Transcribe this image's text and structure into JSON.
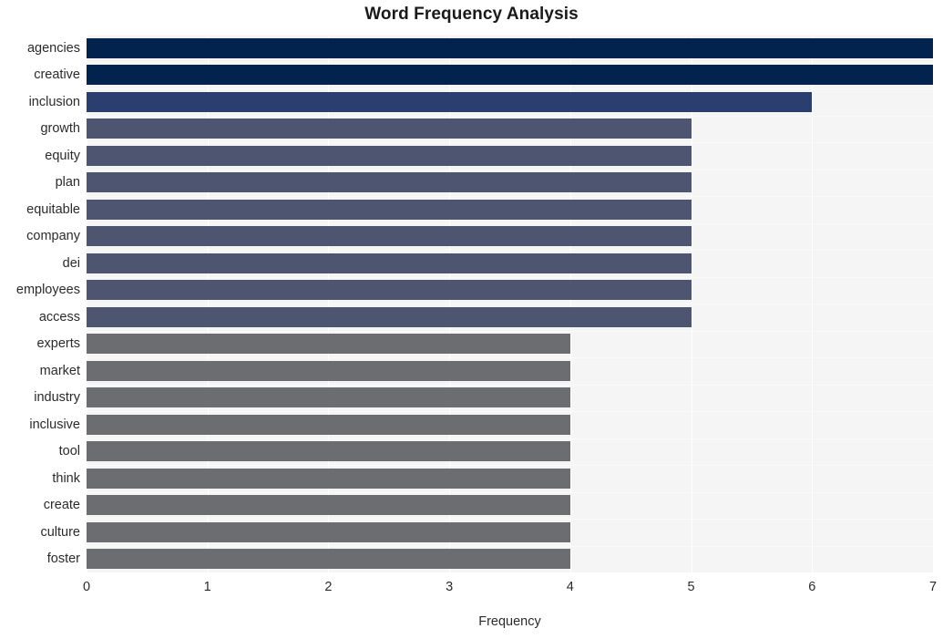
{
  "chart_data": {
    "type": "bar",
    "orientation": "horizontal",
    "title": "Word Frequency Analysis",
    "xlabel": "Frequency",
    "ylabel": "",
    "xlim": [
      0,
      7
    ],
    "xticks": [
      0,
      1,
      2,
      3,
      4,
      5,
      6,
      7
    ],
    "xtick_labels": [
      "0",
      "1",
      "2",
      "3",
      "4",
      "5",
      "6",
      "7"
    ],
    "grid": true,
    "legend": null,
    "categories": [
      "agencies",
      "creative",
      "inclusion",
      "growth",
      "equity",
      "plan",
      "equitable",
      "company",
      "dei",
      "employees",
      "access",
      "experts",
      "market",
      "industry",
      "inclusive",
      "tool",
      "think",
      "create",
      "culture",
      "foster"
    ],
    "values": [
      7,
      7,
      6,
      5,
      5,
      5,
      5,
      5,
      5,
      5,
      5,
      4,
      4,
      4,
      4,
      4,
      4,
      4,
      4,
      4
    ],
    "bar_colors": [
      "#02234d",
      "#02234d",
      "#2a3f70",
      "#4e5571",
      "#4e5571",
      "#4e5571",
      "#4e5571",
      "#4e5571",
      "#4e5571",
      "#4e5571",
      "#4e5571",
      "#6b6d70",
      "#6b6d70",
      "#6b6d70",
      "#6b6d70",
      "#6b6d70",
      "#6b6d70",
      "#6b6d70",
      "#6b6d70",
      "#6b6d70"
    ]
  },
  "style": {
    "plot_background": "#f5f5f5",
    "figure_background": "#ffffff",
    "gridline_color": "#ffffff",
    "text_color": "#2b2b2b",
    "title_color": "#1a1a1a"
  }
}
